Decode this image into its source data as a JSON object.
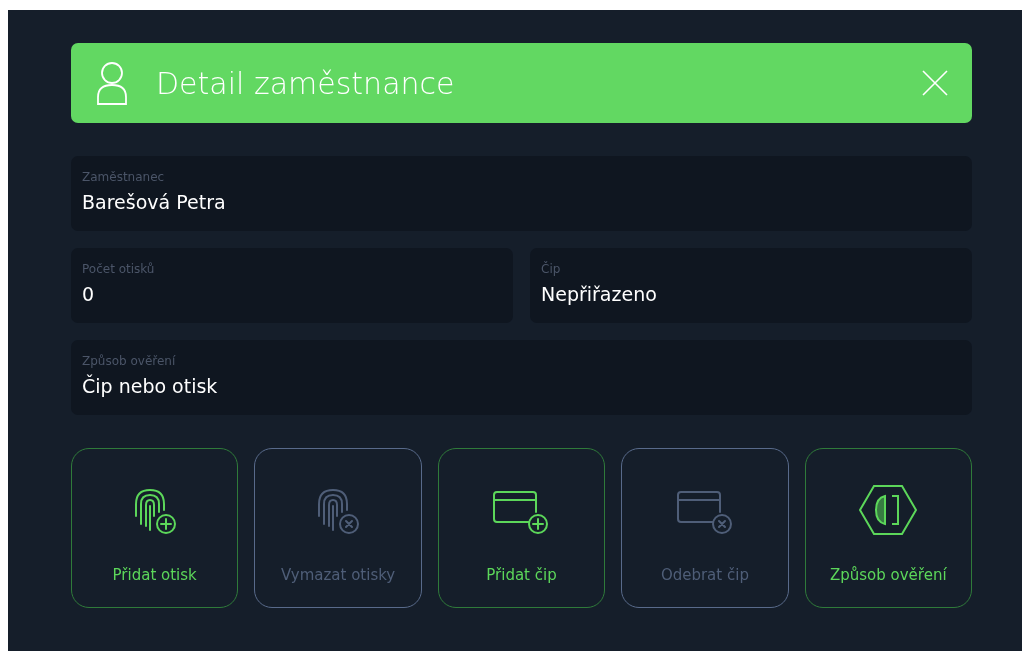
{
  "header": {
    "title": "Detail zaměstnance"
  },
  "fields": [
    {
      "kind": "full",
      "label": "Zaměstnanec",
      "value": "Barešová Petra"
    },
    {
      "kind": "half",
      "label": "Počet otisků",
      "value": "0"
    },
    {
      "kind": "half",
      "label": "Čip",
      "value": "Nepřiřazeno"
    },
    {
      "kind": "full",
      "label": "Způsob ověření",
      "value": "Čip nebo otisk"
    }
  ],
  "actions": [
    {
      "kind": "fingerprint-add",
      "label": "Přidat otisk",
      "disabled": false
    },
    {
      "kind": "fingerprint-remove",
      "label": "Vymazat otisky",
      "disabled": true
    },
    {
      "kind": "card-add",
      "label": "Přidat čip",
      "disabled": false
    },
    {
      "kind": "card-remove",
      "label": "Odebrat čip",
      "disabled": true
    },
    {
      "kind": "method",
      "label": "Způsob ověření",
      "disabled": false
    }
  ]
}
